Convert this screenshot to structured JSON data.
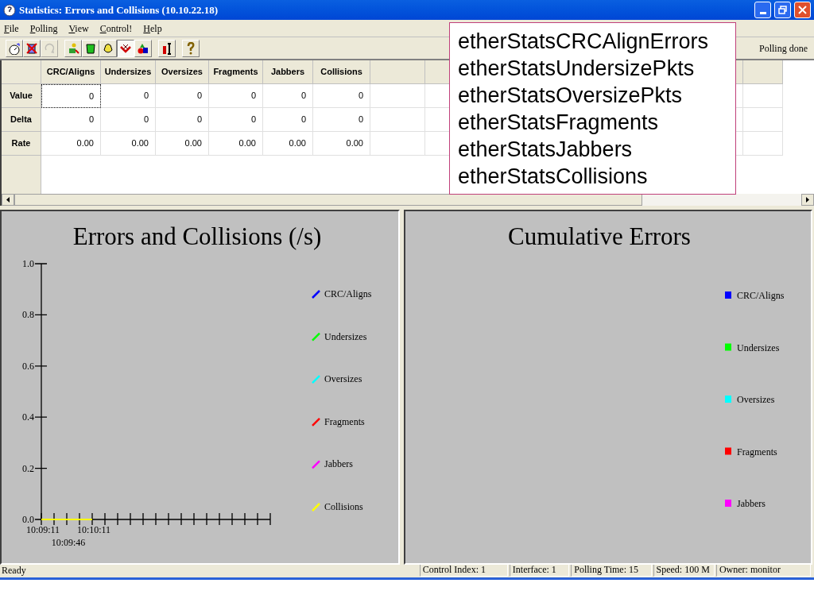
{
  "window": {
    "title": "Statistics: Errors and Collisions (10.10.22.18)"
  },
  "menu": [
    "File",
    "Polling",
    "View",
    "Control!",
    "Help"
  ],
  "toolbar": {
    "groups": [
      [
        {
          "pressed": false,
          "disabled": false
        },
        {
          "pressed": false,
          "disabled": false
        },
        {
          "pressed": false,
          "disabled": true
        }
      ],
      [
        {
          "pressed": false,
          "disabled": false
        },
        {
          "pressed": false,
          "disabled": false
        },
        {
          "pressed": false,
          "disabled": false
        },
        {
          "pressed": true,
          "disabled": false
        },
        {
          "pressed": false,
          "disabled": false
        }
      ],
      [
        {
          "pressed": false,
          "disabled": false
        }
      ],
      [
        {
          "pressed": false,
          "disabled": false
        }
      ]
    ],
    "status": "Polling done"
  },
  "grid": {
    "columns": [
      "CRC/Aligns",
      "Undersizes",
      "Oversizes",
      "Fragments",
      "Jabbers",
      "Collisions"
    ],
    "rows": [
      {
        "label": "Value",
        "cells": [
          {
            "text": "0",
            "selected": true
          },
          {
            "text": "0",
            "selected": false
          },
          {
            "text": "0",
            "selected": false
          },
          {
            "text": "0",
            "selected": false
          },
          {
            "text": "0",
            "selected": false
          },
          {
            "text": "0",
            "selected": false
          }
        ]
      },
      {
        "label": "Delta",
        "cells": [
          {
            "text": "0",
            "selected": false
          },
          {
            "text": "0",
            "selected": false
          },
          {
            "text": "0",
            "selected": false
          },
          {
            "text": "0",
            "selected": false
          },
          {
            "text": "0",
            "selected": false
          },
          {
            "text": "0",
            "selected": false
          }
        ]
      },
      {
        "label": "Rate",
        "cells": [
          {
            "text": "0.00",
            "selected": false
          },
          {
            "text": "0.00",
            "selected": false
          },
          {
            "text": "0.00",
            "selected": false
          },
          {
            "text": "0.00",
            "selected": false
          },
          {
            "text": "0.00",
            "selected": false
          },
          {
            "text": "0.00",
            "selected": false
          }
        ]
      }
    ]
  },
  "callout": {
    "lines": [
      "etherStatsCRCAlignErrors",
      "etherStatsUndersizePkts",
      "etherStatsOversizePkts",
      "etherStatsFragments",
      "etherStatsJabbers",
      "etherStatsCollisions"
    ]
  },
  "rate_chart": {
    "chart_data": {
      "type": "line",
      "title": "Errors and Collisions (/s)",
      "categories": [
        "10:09:11",
        null,
        "10:09:46",
        null,
        "10:10:11",
        null,
        null,
        null,
        null,
        null,
        null,
        null,
        null,
        null,
        null,
        null,
        null,
        null,
        null
      ],
      "ylim": [
        0,
        1
      ],
      "yticks": [
        {
          "value": 0,
          "label": "0.0"
        },
        {
          "value": 0.2,
          "label": "0.2"
        },
        {
          "value": 0.4,
          "label": "0.4"
        },
        {
          "value": 0.6,
          "label": "0.6"
        },
        {
          "value": 0.8,
          "label": "0.8"
        },
        {
          "value": 1,
          "label": "1.0"
        }
      ],
      "series": [
        {
          "name": "CRC/Aligns",
          "color": "#0000ff",
          "values": [
            null,
            null,
            null,
            null,
            null,
            null,
            null,
            null,
            null,
            null,
            null,
            null,
            null,
            null,
            null,
            null,
            null,
            null,
            null
          ]
        },
        {
          "name": "Undersizes",
          "color": "#00ff00",
          "values": [
            null,
            null,
            null,
            null,
            null,
            null,
            null,
            null,
            null,
            null,
            null,
            null,
            null,
            null,
            null,
            null,
            null,
            null,
            null
          ]
        },
        {
          "name": "Oversizes",
          "color": "#00ffff",
          "values": [
            null,
            null,
            null,
            null,
            null,
            null,
            null,
            null,
            null,
            null,
            null,
            null,
            null,
            null,
            null,
            null,
            null,
            null,
            null
          ]
        },
        {
          "name": "Fragments",
          "color": "#ff0000",
          "values": [
            null,
            null,
            null,
            null,
            null,
            null,
            null,
            null,
            null,
            null,
            null,
            null,
            null,
            null,
            null,
            null,
            null,
            null,
            null
          ]
        },
        {
          "name": "Jabbers",
          "color": "#ff00ff",
          "values": [
            null,
            null,
            null,
            null,
            null,
            null,
            null,
            null,
            null,
            null,
            null,
            null,
            null,
            null,
            null,
            null,
            null,
            null,
            null
          ]
        },
        {
          "name": "Collisions",
          "color": "#ffff00",
          "values": [
            0,
            0,
            0,
            0,
            0,
            null,
            null,
            null,
            null,
            null,
            null,
            null,
            null,
            null,
            null,
            null,
            null,
            null,
            null
          ]
        }
      ]
    }
  },
  "cumulative_chart": {
    "title": "Cumulative Errors",
    "legend": [
      {
        "label": "CRC/Aligns",
        "color": "#0000ff"
      },
      {
        "label": "Undersizes",
        "color": "#00ff00"
      },
      {
        "label": "Oversizes",
        "color": "#00ffff"
      },
      {
        "label": "Fragments",
        "color": "#ff0000"
      },
      {
        "label": "Jabbers",
        "color": "#ff00ff"
      }
    ]
  },
  "status_bar": {
    "message": "Ready",
    "panes": [
      "Control Index: 1",
      "Interface: 1",
      "Polling Time: 15",
      "Speed: 100 M",
      "Owner: monitor"
    ]
  }
}
